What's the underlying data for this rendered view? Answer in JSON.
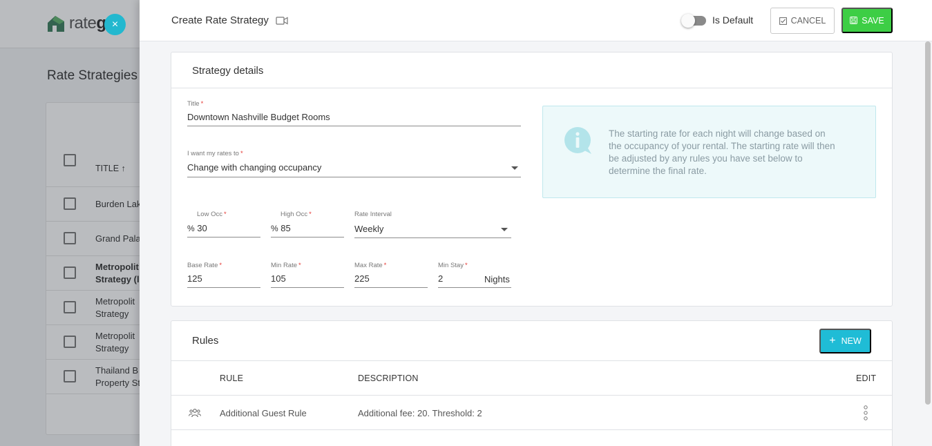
{
  "background": {
    "logo_text_a": "rate",
    "logo_text_b": "go",
    "logo_text_c": "e",
    "page_title": "Rate Strategies",
    "table_header": "TITLE ↑",
    "rows": [
      {
        "line1": "Burden Lak",
        "line2": ""
      },
      {
        "line1": "Grand Pala",
        "line2": ""
      },
      {
        "line1": "Metropolit",
        "line2": "Strategy (l"
      },
      {
        "line1": "Metropolit",
        "line2": "Strategy"
      },
      {
        "line1": "Metropolit",
        "line2": "Strategy"
      },
      {
        "line1": "Thailand B",
        "line2": "Property St"
      }
    ]
  },
  "close_label": "×",
  "header": {
    "title": "Create Rate Strategy",
    "is_default_label": "Is Default",
    "is_default": false,
    "cancel_label": "CANCEL",
    "save_label": "SAVE"
  },
  "details": {
    "title": "Strategy details",
    "title_field": {
      "label": "Title",
      "value": "Downtown Nashville Budget Rooms"
    },
    "mode_field": {
      "label": "I want my rates to",
      "value": "Change with changing occupancy"
    },
    "low_occ": {
      "label": "Low Occ",
      "prefix": "%",
      "value": "30"
    },
    "high_occ": {
      "label": "High Occ",
      "prefix": "%",
      "value": "85"
    },
    "rate_interval": {
      "label": "Rate Interval",
      "value": "Weekly"
    },
    "base_rate": {
      "label": "Base Rate",
      "value": "125"
    },
    "min_rate": {
      "label": "Min Rate",
      "value": "105"
    },
    "max_rate": {
      "label": "Max Rate",
      "value": "225"
    },
    "min_stay": {
      "label": "Min Stay",
      "value": "2",
      "suffix": "Nights"
    },
    "required_mark": "*",
    "info_text": "The starting rate for each night will change based on the occupancy of your rental. The starting rate will then be adjusted by any rules you have set below to determine the final rate."
  },
  "rules": {
    "title": "Rules",
    "new_label": "NEW",
    "columns": {
      "rule": "RULE",
      "description": "DESCRIPTION",
      "edit": "EDIT"
    },
    "rows": [
      {
        "rule": "Additional Guest Rule",
        "description": "Additional fee: 20. Threshold: 2",
        "icon": "guests-icon"
      }
    ]
  },
  "colors": {
    "accent": "#1fbcd6",
    "save": "#3dce45",
    "info_bg": "#edf9fa",
    "info_icon": "#b3e4ea"
  }
}
